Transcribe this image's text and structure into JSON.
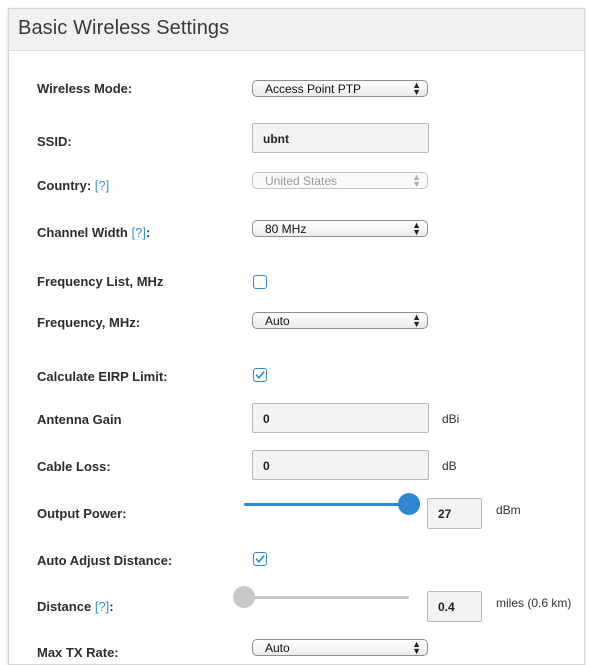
{
  "panel": {
    "title": "Basic Wireless Settings"
  },
  "fields": {
    "wireless_mode": {
      "label": "Wireless Mode:",
      "value": "Access Point PTP"
    },
    "ssid": {
      "label": "SSID:",
      "value": "ubnt"
    },
    "country": {
      "label": "Country:",
      "help": "[?]",
      "value": "United States"
    },
    "channel_width": {
      "label": "Channel Width",
      "help": "[?]",
      "suffix": ":",
      "value": "80 MHz"
    },
    "frequency_list": {
      "label": "Frequency List, MHz",
      "checked": false
    },
    "frequency": {
      "label": "Frequency, MHz:",
      "value": "Auto"
    },
    "calc_eirp": {
      "label": "Calculate EIRP Limit:",
      "checked": true
    },
    "antenna_gain": {
      "label": "Antenna Gain",
      "value": "0",
      "unit": "dBi"
    },
    "cable_loss": {
      "label": "Cable Loss:",
      "value": "0",
      "unit": "dB"
    },
    "output_power": {
      "label": "Output Power:",
      "value": "27",
      "unit": "dBm",
      "slider_level": 1.0
    },
    "auto_adjust_distance": {
      "label": "Auto Adjust Distance:",
      "checked": true
    },
    "distance": {
      "label": "Distance",
      "help": "[?]",
      "suffix": ":",
      "value": "0.4",
      "unit": "miles (0.6 km)",
      "slider_level": 0.0
    },
    "max_tx_rate": {
      "label": "Max TX Rate:",
      "value": "Auto"
    }
  },
  "colors": {
    "accent": "#2f86d3",
    "help_link": "#3a8fd2",
    "slider_inactive": "#c8c8c8"
  },
  "icons": {
    "select_arrows": "up-down-chevron-icon",
    "checkmark": "checkmark-icon"
  }
}
